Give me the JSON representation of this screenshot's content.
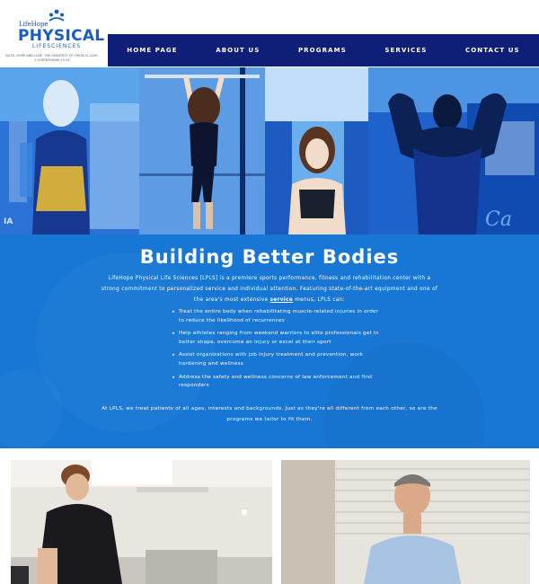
{
  "brand": {
    "small": "LifeHope",
    "name": "PHYSICAL",
    "sub": "LIFESCIENCES",
    "tagline": "FAITH, HOPE AND LOVE. THE GREATEST OF THESE IS LOVE.",
    "verse": "1 CORINTHIANS 13:13",
    "color": "#1a5cc0"
  },
  "nav": {
    "items": [
      "HOME PAGE",
      "ABOUT US",
      "PROGRAMS",
      "SERVICES",
      "CONTACT US"
    ],
    "bg": "#0f1f78"
  },
  "hero": {
    "tint": "#1a55c4"
  },
  "main": {
    "headline": "Building Better Bodies",
    "intro_before": "LifeHope Physical Life Sciences [LPLS] is a premiere sports performance, fitness and rehabilitation center with a strong commitment to personalized service and individual attention. Featuring state-of-the-art equipment and one of the area's most extensive ",
    "intro_link": "service",
    "intro_after": " menus, LPLS can:",
    "bullets": [
      "Treat the entire body when rehabilitating muscle-related injuries in order to reduce the likelihood of recurrences",
      "Help athletes ranging from weekend warriors to elite professionals get in better shape, overcome an injury or excel at their sport",
      "Assist organizations with job injury treatment and prevention, work hardening and wellness",
      "Address the safety and wellness concerns of law enforcement and first responders"
    ],
    "closing": "At LPLS, we treat patients of all ages, interests and backgrounds. Just as they're all different from each other, so are the programs we tailor to fit them.",
    "bg": "#1877d4"
  }
}
